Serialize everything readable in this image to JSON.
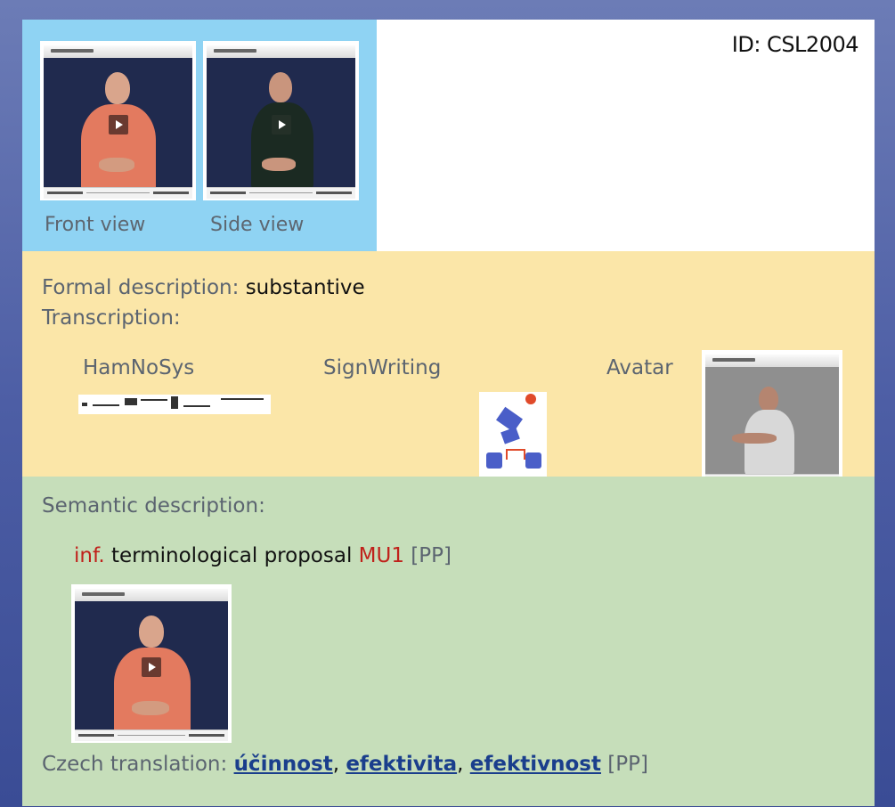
{
  "id_label": "ID: CSL2004",
  "video_section": {
    "front_label": "Front view",
    "side_label": "Side view"
  },
  "formal": {
    "prefix": "Formal description:",
    "value": "substantive",
    "transcription_label": "Transcription:",
    "hamnosys_label": "HamNoSys",
    "signwriting_label": "SignWriting",
    "avatar_label": "Avatar"
  },
  "semantic": {
    "label": "Semantic description:",
    "abbrev": "inf.",
    "text": "terminological proposal",
    "code": "MU1",
    "source": "[PP]"
  },
  "translation": {
    "prefix": "Czech translation:",
    "words": [
      "účinnost",
      "efektivita",
      "efektivnost"
    ],
    "separator": ",",
    "source": "[PP]"
  },
  "colors": {
    "video_bg": "#8fd3f3",
    "formal_bg": "#fbe6a8",
    "semantic_bg": "#c6deba",
    "accent_red": "#c0211b",
    "link_blue": "#1a3e8c"
  },
  "icons": [
    "play-icon",
    "signwriting-glyph"
  ]
}
